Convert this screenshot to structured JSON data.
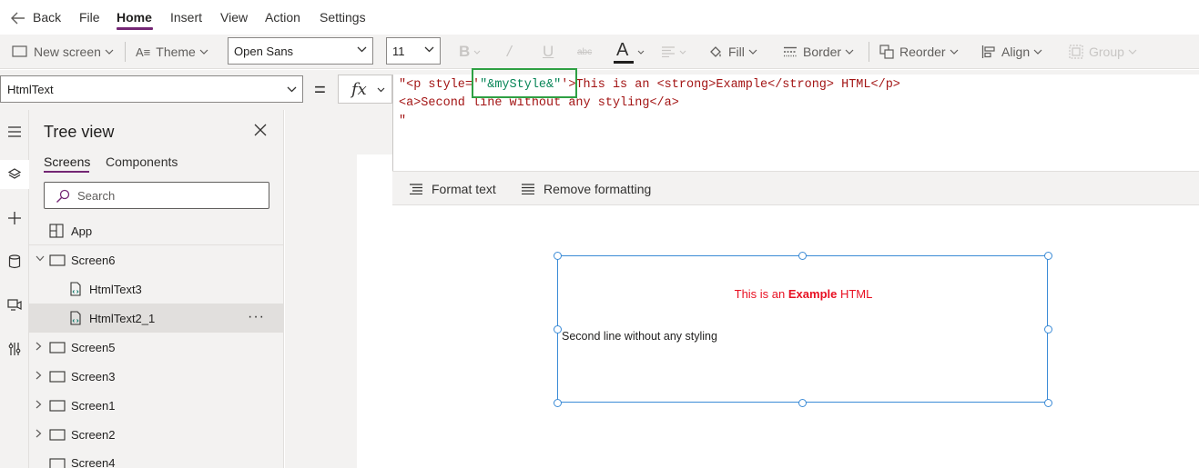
{
  "menu": {
    "back_label": "Back",
    "items": [
      "File",
      "Home",
      "Insert",
      "View",
      "Action",
      "Settings"
    ],
    "active": "Home",
    "accent_color": "#742774"
  },
  "toolbar": {
    "new_screen": "New screen",
    "theme": "Theme",
    "font_family": "Open Sans",
    "font_size": "11",
    "bold": "B",
    "italic": "/",
    "underline": "U",
    "strike": "abc",
    "font_color_letter": "A",
    "fill": "Fill",
    "border": "Border",
    "reorder": "Reorder",
    "align": "Align",
    "group": "Group"
  },
  "formula": {
    "property": "HtmlText",
    "equals": "=",
    "fx": "fx",
    "line1_a": "\"<p style='",
    "line1_b": "\"&myStyle&\"",
    "line1_c": "'>This is an <strong>Example</strong> HTML</p>",
    "line2": "<a>Second line without any styling</a>",
    "line3": "\"",
    "highlight_color": "#2ea043"
  },
  "format_bar": {
    "format_text": "Format text",
    "remove_formatting": "Remove formatting"
  },
  "tree": {
    "title": "Tree view",
    "tabs": [
      "Screens",
      "Components"
    ],
    "active_tab": "Screens",
    "search_placeholder": "Search",
    "items": [
      {
        "label": "App",
        "type": "app"
      },
      {
        "label": "Screen6",
        "type": "screen",
        "expanded": true
      },
      {
        "label": "HtmlText3",
        "type": "html"
      },
      {
        "label": "HtmlText2_1",
        "type": "html",
        "selected": true
      },
      {
        "label": "Screen5",
        "type": "screen"
      },
      {
        "label": "Screen3",
        "type": "screen"
      },
      {
        "label": "Screen1",
        "type": "screen"
      },
      {
        "label": "Screen2",
        "type": "screen"
      },
      {
        "label": "Screen4",
        "type": "screen"
      }
    ],
    "more": "···"
  },
  "canvas": {
    "html_line1_pre": "This is an ",
    "html_line1_strong": "Example",
    "html_line1_post": " HTML",
    "html_line2": "Second line without any styling",
    "selection_color": "#3b8bd6",
    "text_red": "#e81123"
  },
  "icons": [
    "back-arrow-icon",
    "new-screen-icon",
    "theme-icon",
    "font-color-icon",
    "align-text-icon",
    "fill-icon",
    "border-icon",
    "reorder-icon",
    "align-icon",
    "group-icon",
    "hamburger-icon",
    "layers-icon",
    "plus-icon",
    "database-icon",
    "media-icon",
    "tools-icon",
    "close-icon",
    "search-icon",
    "format-text-icon",
    "remove-formatting-icon"
  ]
}
